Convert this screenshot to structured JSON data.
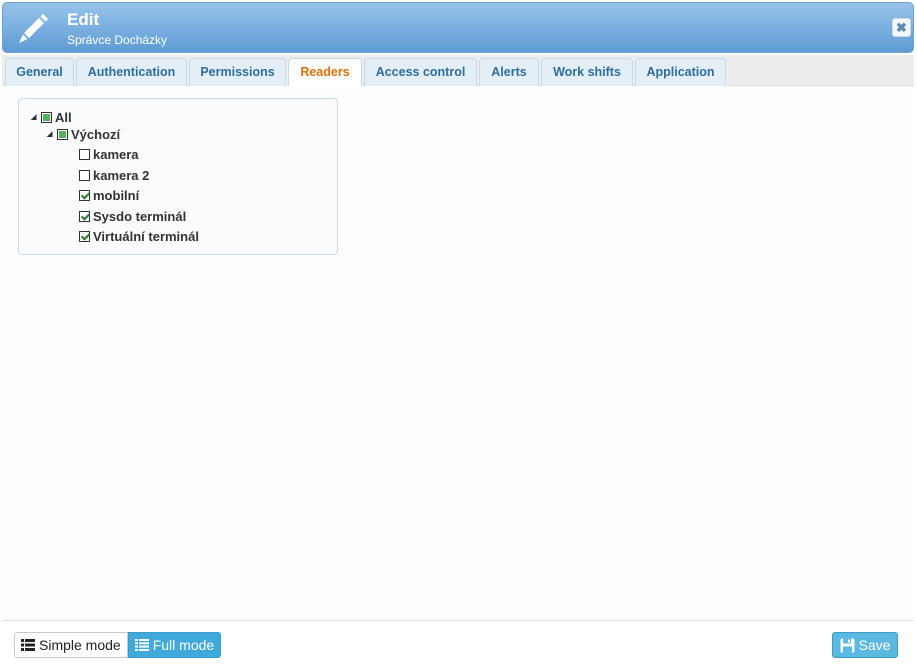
{
  "window": {
    "title": "Edit",
    "subtitle": "Správce Docházky",
    "close_glyph": "✖",
    "title_icon": "pencil-icon"
  },
  "tabs": [
    {
      "label": "General"
    },
    {
      "label": "Authentication"
    },
    {
      "label": "Permissions"
    },
    {
      "label": "Readers",
      "active": true
    },
    {
      "label": "Access control"
    },
    {
      "label": "Alerts"
    },
    {
      "label": "Work shifts"
    },
    {
      "label": "Application"
    }
  ],
  "tree": {
    "root": {
      "label": "All",
      "state": "partial",
      "expanded": true
    },
    "group": {
      "label": "Výchozí",
      "state": "partial",
      "expanded": true
    },
    "items": [
      {
        "label": "kamera",
        "checked": false
      },
      {
        "label": "kamera 2",
        "checked": false
      },
      {
        "label": "mobilní",
        "checked": true
      },
      {
        "label": "Sysdo terminál",
        "checked": true
      },
      {
        "label": "Virtuální terminál",
        "checked": true
      }
    ]
  },
  "footer": {
    "simple_mode_label": "Simple mode",
    "full_mode_label": "Full mode",
    "active_mode": "Full mode",
    "save_label": "Save"
  },
  "colors": {
    "titlebar": "#7eb2e1",
    "active_tab_text": "#e17009",
    "tab_text": "#2e6e9e",
    "accent_button": "#3fa9d9",
    "checkbox_fill": "#55b45b"
  }
}
